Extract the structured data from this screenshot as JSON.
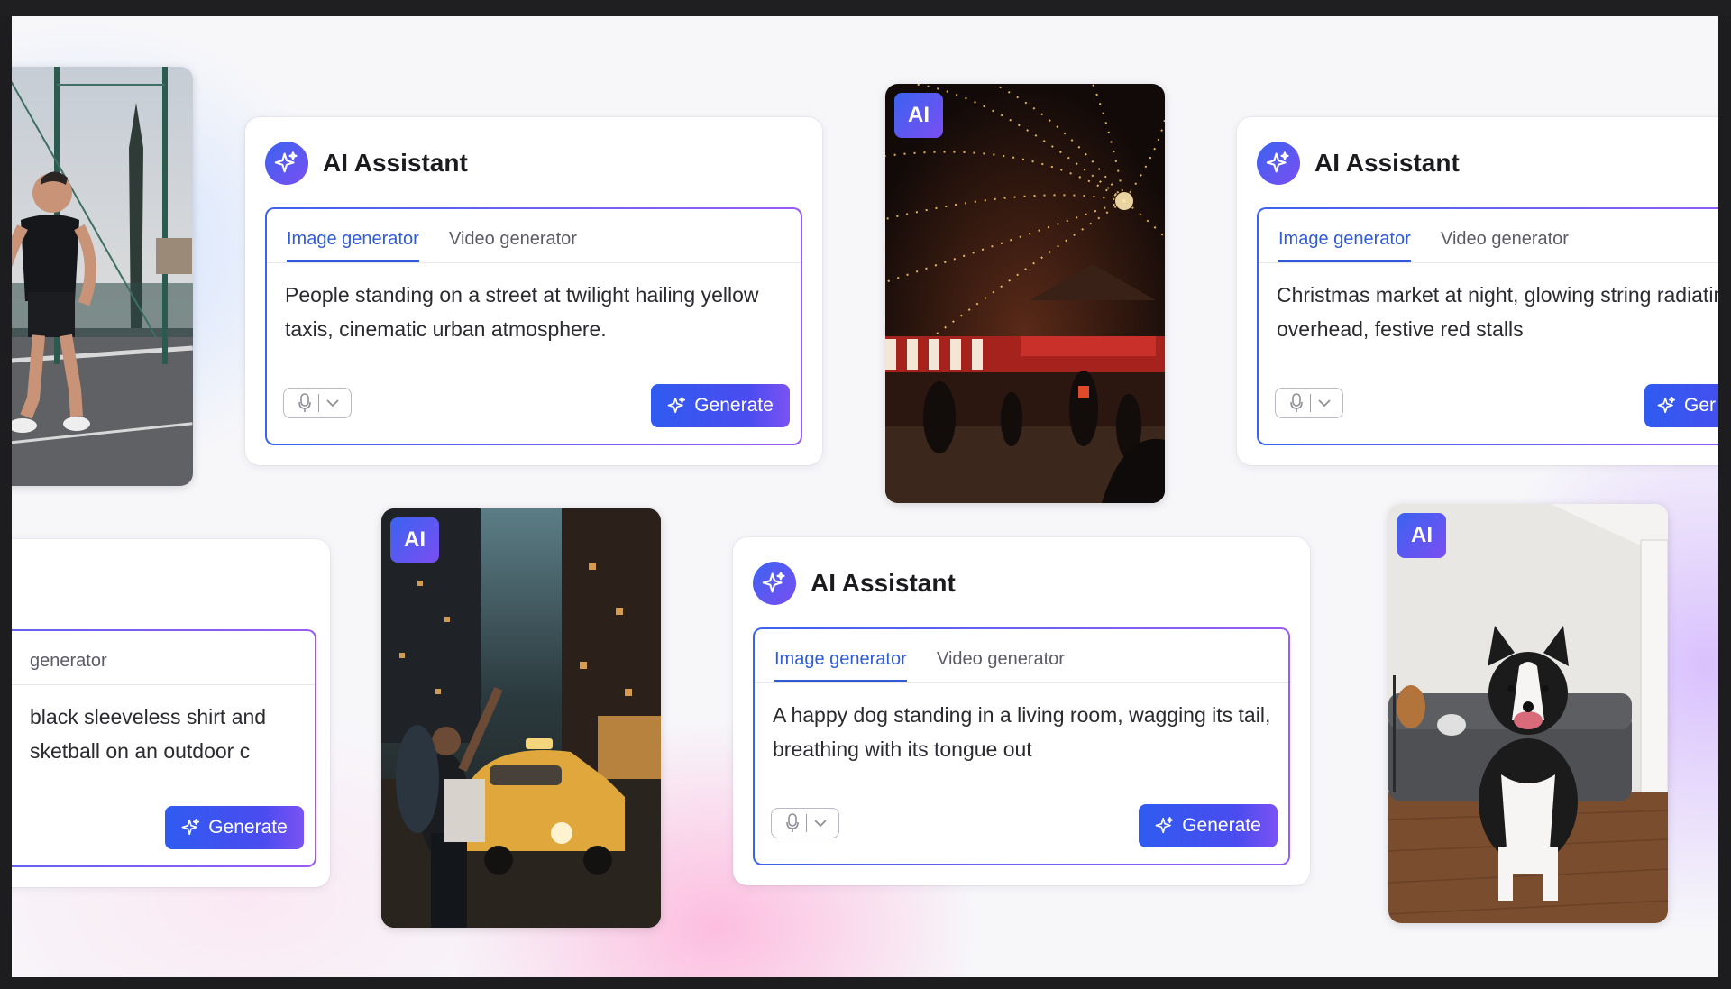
{
  "window": {
    "title_bar_text": ""
  },
  "assistant_title": "AI Assistant",
  "ai_badge": "AI",
  "tabs": {
    "image": "Image generator",
    "video": "Video generator"
  },
  "generate_label": "Generate",
  "cards": [
    {
      "id": "taxi",
      "tab_image": "Image generator",
      "tab_video": "Video generator",
      "prompt": "People standing on a street at twilight hailing yellow taxis, cinematic urban atmosphere."
    },
    {
      "id": "christmas",
      "tab_image": "Image generator",
      "tab_video": "Video generator",
      "prompt": "Christmas market at night, glowing string radiating overhead, festive red stalls"
    },
    {
      "id": "basketball",
      "tab_video_visible": "generator",
      "prompt_line1": "black sleeveless shirt and",
      "prompt_line2": "sketball on an outdoor c"
    },
    {
      "id": "dog",
      "tab_image": "Image generator",
      "tab_video": "Video generator",
      "prompt": "A happy dog standing in a living room, wagging its tail, breathing with its tongue out"
    }
  ],
  "generate_partial_label": "Ger",
  "colors": {
    "accent_blue": "#2f5bd8",
    "button_gradient_start": "#2f5bf0",
    "button_gradient_end": "#7b52f3",
    "icon_gradient_start": "#3b63f0",
    "icon_gradient_end": "#7a4ef2",
    "canvas_bg": "#f7f7fa",
    "frame_bg": "#1d1d1f"
  },
  "icons": {
    "assistant": "sparkle-icon",
    "mic": "microphone-icon",
    "dropdown": "chevron-down-icon",
    "generate": "sparkle-icon"
  }
}
